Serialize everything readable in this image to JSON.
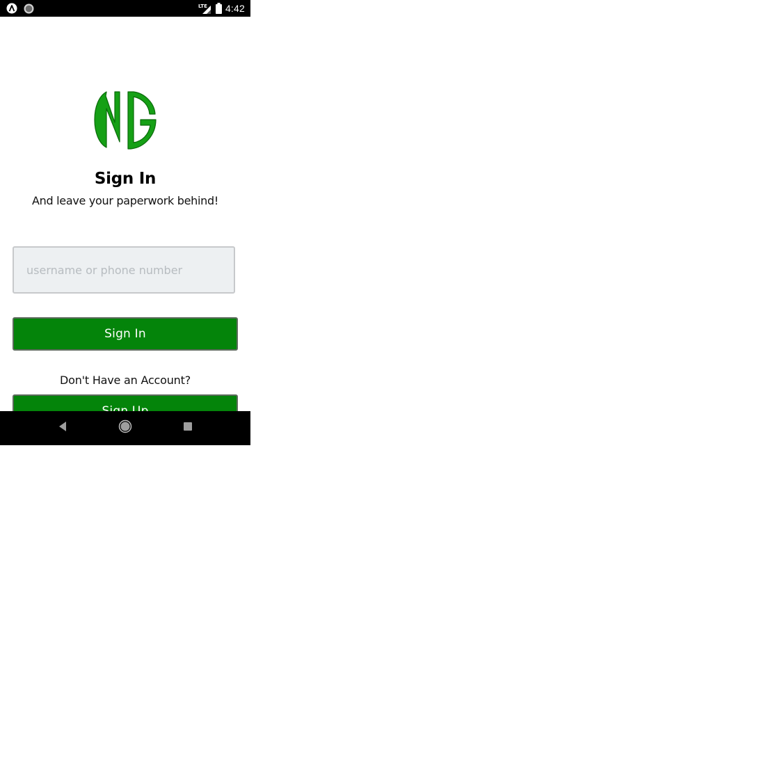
{
  "status_bar": {
    "time": "4:42",
    "network_label": "LTE",
    "icons": [
      "app-notification-icon",
      "circle-notification-icon",
      "lte-signal-icon",
      "battery-icon"
    ]
  },
  "logo": {
    "text": "NG",
    "color": "#16a016"
  },
  "header": {
    "title": "Sign In",
    "subtitle": "And leave your paperwork behind!"
  },
  "form": {
    "username_placeholder": "username or phone number",
    "username_value": "",
    "sign_in_label": "Sign In"
  },
  "signup": {
    "question": "Don't Have an Account?",
    "sign_up_label": "Sign Up"
  },
  "nav_bar": {
    "icons": [
      "back-icon",
      "home-icon",
      "recent-apps-icon"
    ]
  },
  "colors": {
    "accent": "#04840a",
    "input_bg": "#edf0f2",
    "status_bar": "#000000"
  }
}
